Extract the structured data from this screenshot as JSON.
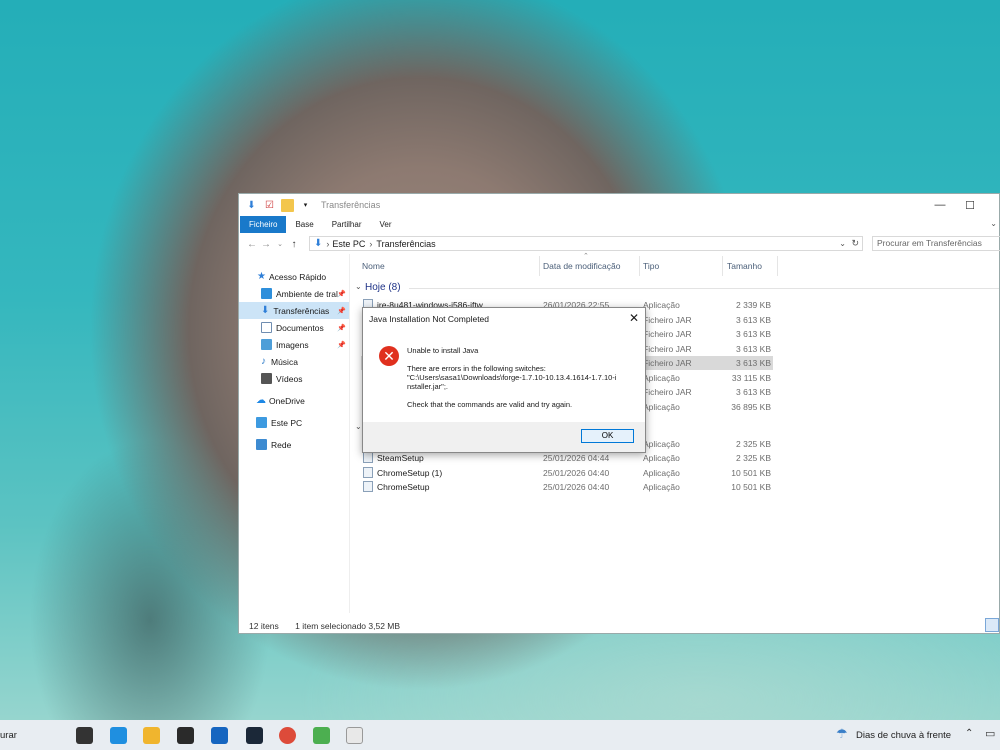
{
  "explorer": {
    "title": "Transferências",
    "ribbon_tabs": [
      "Ficheiro",
      "Base",
      "Partilhar",
      "Ver"
    ],
    "address": {
      "root": "Este PC",
      "folder": "Transferências"
    },
    "search_placeholder": "Procurar em Transferências",
    "nav": [
      {
        "label": "Acesso Rápido",
        "icon": "star-icon",
        "color": "#2f7fd8"
      },
      {
        "label": "Ambiente de tral",
        "icon": "desktop-icon",
        "color": "#2e8fdb"
      },
      {
        "label": "Transferências",
        "icon": "download-icon",
        "color": "#2f7fd8"
      },
      {
        "label": "Documentos",
        "icon": "documents-icon",
        "color": "#6f8db1"
      },
      {
        "label": "Imagens",
        "icon": "pictures-icon",
        "color": "#4e9ed8"
      },
      {
        "label": "Música",
        "icon": "music-icon",
        "color": "#2c7ac8"
      },
      {
        "label": "Vídeos",
        "icon": "videos-icon",
        "color": "#555555"
      },
      {
        "label": "OneDrive",
        "icon": "cloud-icon",
        "color": "#1e88e5"
      },
      {
        "label": "Este PC",
        "icon": "computer-icon",
        "color": "#3d9ae0"
      },
      {
        "label": "Rede",
        "icon": "network-icon",
        "color": "#3d8bd1"
      }
    ],
    "columns": [
      "Nome",
      "Data de modificação",
      "Tipo",
      "Tamanho"
    ],
    "group_today": "Hoje (8)",
    "files": [
      {
        "name": "jre-8u481-windows-i586-iftw",
        "date": "26/01/2026 22:55",
        "type": "Aplicação",
        "size": "2 339 KB"
      },
      {
        "name": "",
        "date": "",
        "type": "Ficheiro JAR",
        "size": "3 613 KB"
      },
      {
        "name": "",
        "date": "",
        "type": "Ficheiro JAR",
        "size": "3 613 KB"
      },
      {
        "name": "",
        "date": "",
        "type": "Ficheiro JAR",
        "size": "3 613 KB"
      },
      {
        "name": "",
        "date": "",
        "type": "Ficheiro JAR",
        "size": "3 613 KB"
      },
      {
        "name": "",
        "date": "",
        "type": "Aplicação",
        "size": "33 115 KB"
      },
      {
        "name": "",
        "date": "",
        "type": "Ficheiro JAR",
        "size": "3 613 KB"
      },
      {
        "name": "",
        "date": "",
        "type": "Aplicação",
        "size": "36 895 KB"
      },
      {
        "name": "",
        "date": "",
        "type": "Aplicação",
        "size": "2 325 KB"
      },
      {
        "name": "SteamSetup",
        "date": "25/01/2026 04:44",
        "type": "Aplicação",
        "size": "2 325 KB"
      },
      {
        "name": "ChromeSetup (1)",
        "date": "25/01/2026 04:40",
        "type": "Aplicação",
        "size": "10 501 KB"
      },
      {
        "name": "ChromeSetup",
        "date": "25/01/2026 04:40",
        "type": "Aplicação",
        "size": "10 501 KB"
      }
    ],
    "status": {
      "count": "12 itens",
      "selection": "1 item selecionado 3,52 MB"
    }
  },
  "dialog": {
    "title": "Java Installation Not Completed",
    "heading": "Unable to install Java",
    "line1": "There are errors in the following switches:",
    "line2": "\"C:\\Users\\sasa1\\Downloads\\forge-1.7.10-10.13.4.1614-1.7.10-i",
    "line3": "nstaller.jar\";.",
    "line4": "Check that the commands are valid and try again.",
    "ok_label": "OK"
  },
  "taskbar": {
    "search_text": "urar",
    "weather_text": "Dias de chuva à frente",
    "apps": [
      "task-view-icon",
      "edge-icon",
      "file-explorer-icon",
      "store-icon",
      "outlook-icon",
      "steam-icon",
      "chrome-icon",
      "minecraft-icon",
      "java-installer-icon"
    ]
  }
}
